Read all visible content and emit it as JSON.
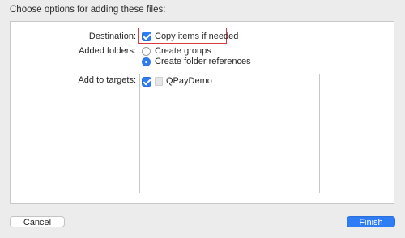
{
  "dialog": {
    "title": "Choose options for adding these files:"
  },
  "destination": {
    "label": "Destination:",
    "option": "Copy items if needed",
    "checked": true
  },
  "added_folders": {
    "label": "Added folders:",
    "options": [
      {
        "label": "Create groups",
        "selected": false
      },
      {
        "label": "Create folder references",
        "selected": true
      }
    ]
  },
  "targets": {
    "label": "Add to targets:",
    "items": [
      {
        "label": "QPayDemo",
        "checked": true,
        "icon": "app-target-icon"
      }
    ]
  },
  "buttons": {
    "cancel": "Cancel",
    "finish": "Finish"
  },
  "colors": {
    "accent": "#2e7cf6",
    "highlight": "#d93a3a",
    "panel_bg": "#ffffff",
    "window_bg": "#ececec"
  }
}
